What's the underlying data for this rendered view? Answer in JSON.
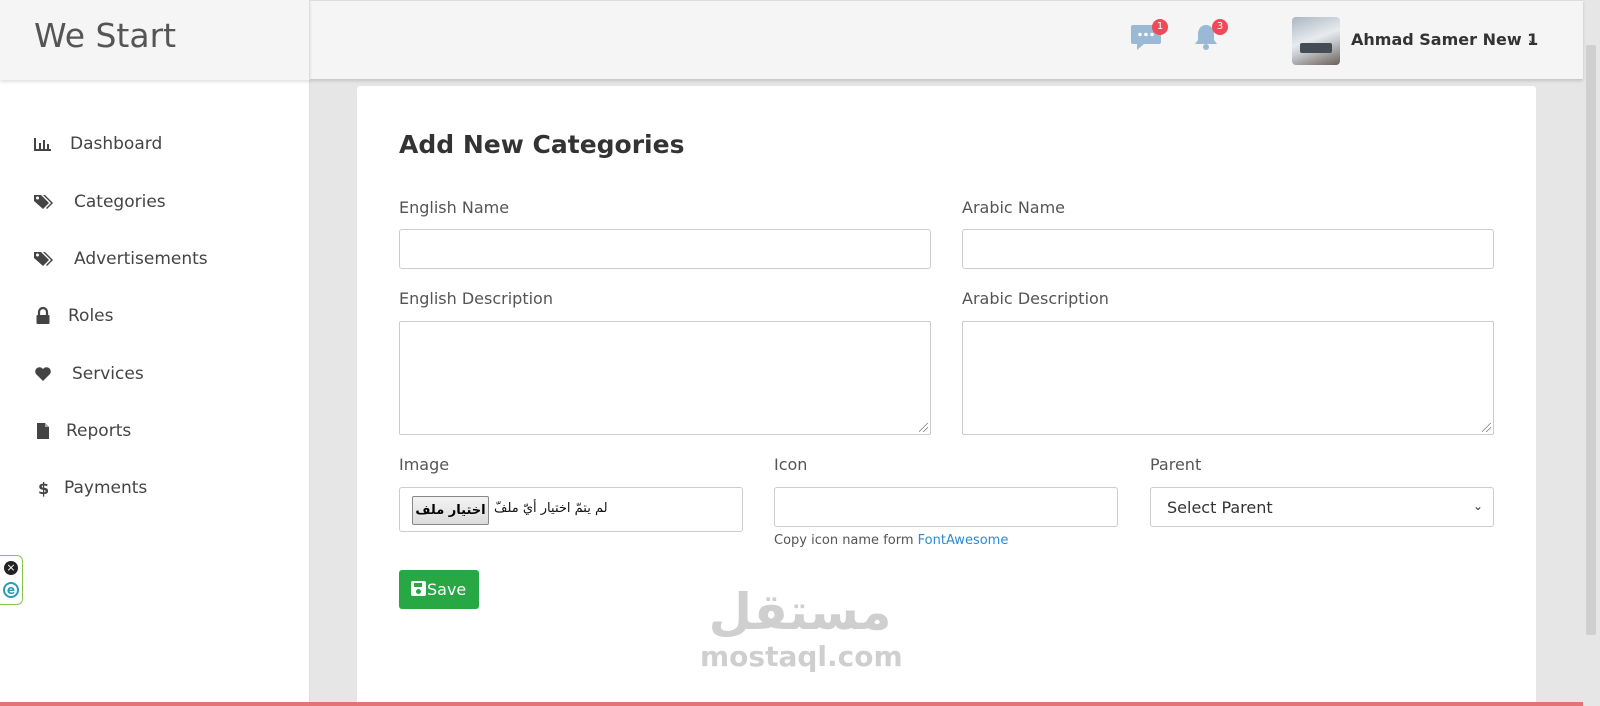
{
  "brand": {
    "title": "We Start"
  },
  "header": {
    "messages_badge": "1",
    "notifications_badge": "3",
    "user_name": "Ahmad Samer New 1"
  },
  "sidebar": {
    "items": [
      {
        "label": "Dashboard",
        "icon": "bar-chart-icon"
      },
      {
        "label": "Categories",
        "icon": "tags-icon"
      },
      {
        "label": "Advertisements",
        "icon": "tags-icon"
      },
      {
        "label": "Roles",
        "icon": "lock-icon"
      },
      {
        "label": "Services",
        "icon": "heart-icon"
      },
      {
        "label": "Reports",
        "icon": "file-icon"
      },
      {
        "label": "Payments",
        "icon": "dollar-icon"
      }
    ]
  },
  "form": {
    "title": "Add New Categories",
    "english_name_label": "English Name",
    "arabic_name_label": "Arabic Name",
    "english_description_label": "English Description",
    "arabic_description_label": "Arabic Description",
    "image_label": "Image",
    "file_button": "اختيار ملف",
    "file_status": "لم يتمّ اختيار أيّ ملفّ",
    "icon_label": "Icon",
    "icon_help_prefix": "Copy icon name form ",
    "icon_help_link": "FontAwesome",
    "parent_label": "Parent",
    "parent_selected": "Select Parent",
    "save_label": "Save"
  },
  "watermark": {
    "arabic": "مستقل",
    "latin": "mostaql.com"
  },
  "colors": {
    "accent_green": "#28a745",
    "badge_red": "#ef4a5a",
    "link_blue": "#2d8ad6"
  }
}
